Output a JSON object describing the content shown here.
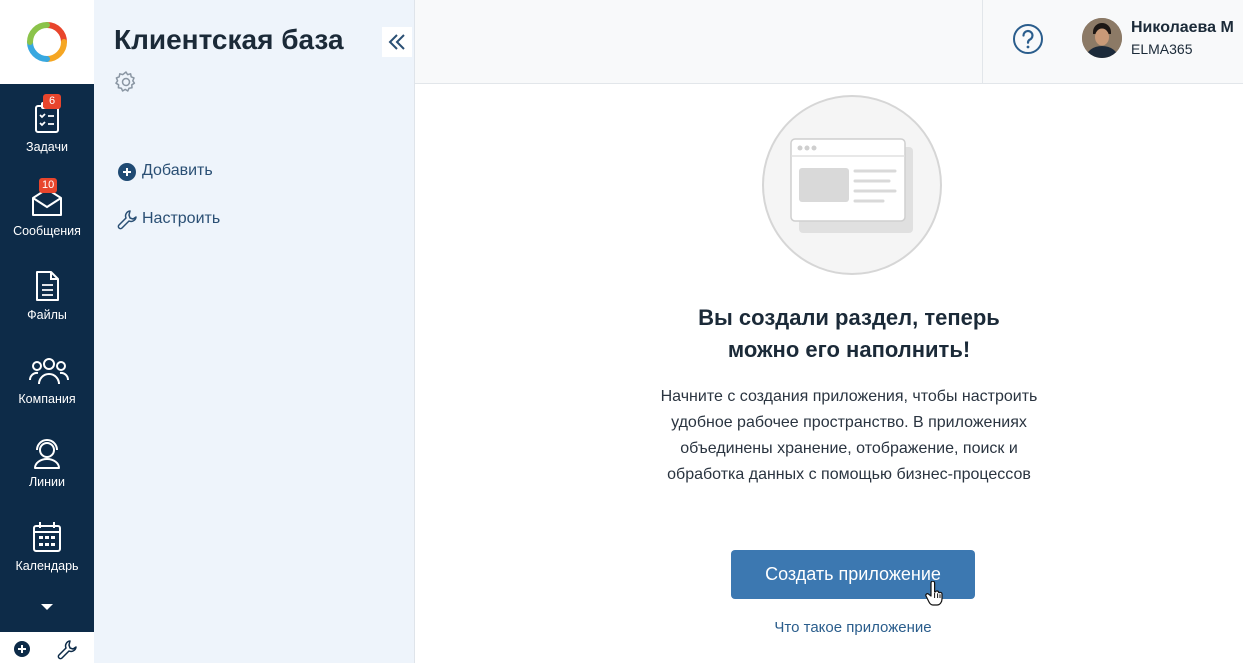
{
  "nav": {
    "items": [
      {
        "label": "Задачи",
        "badge": "6",
        "icon": "tasks-icon"
      },
      {
        "label": "Сообщения",
        "badge": "10",
        "icon": "messages-icon"
      },
      {
        "label": "Файлы",
        "badge": "",
        "icon": "files-icon"
      },
      {
        "label": "Компания",
        "badge": "",
        "icon": "company-icon"
      },
      {
        "label": "Линии",
        "badge": "",
        "icon": "lines-icon"
      },
      {
        "label": "Календарь",
        "badge": "",
        "icon": "calendar-icon"
      }
    ]
  },
  "section": {
    "title": "Клиентская база",
    "add_label": "Добавить",
    "configure_label": "Настроить"
  },
  "header": {
    "user_name": "Николаева М",
    "user_org": "ELMA365"
  },
  "empty_state": {
    "heading_line1": "Вы создали раздел, теперь",
    "heading_line2": "можно его наполнить!",
    "description": "Начните с создания приложения, чтобы настроить удобное рабочее пространство. В приложениях объединены хранение, отображение, поиск и обработка данных с помощью бизнес-процессов",
    "cta_label": "Создать приложение",
    "link_label": "Что такое приложение"
  },
  "colors": {
    "rail": "#0d2b48",
    "panel": "#eef4fb",
    "accent": "#3c78b1",
    "badge": "#e8452c"
  }
}
